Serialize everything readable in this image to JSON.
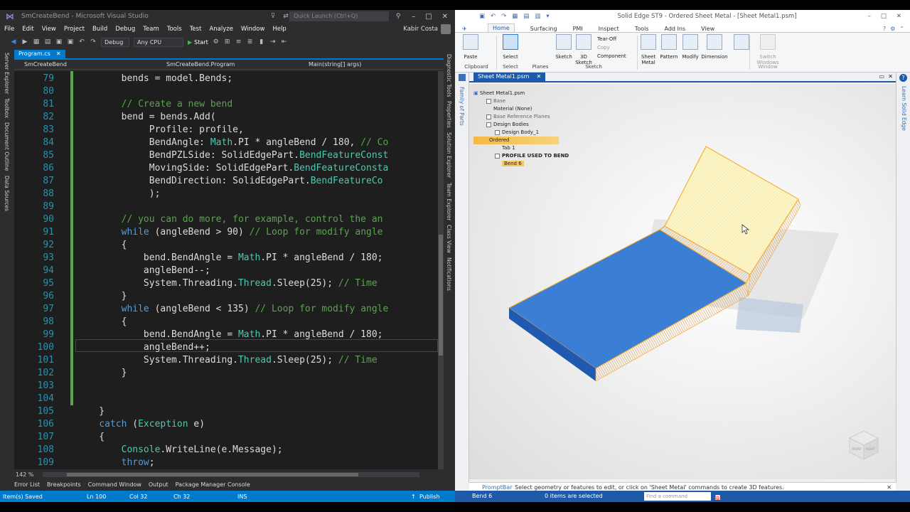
{
  "vs": {
    "window_title": "SmCreateBend - Microsoft Visual Studio",
    "quick_launch_placeholder": "Quick Launch (Ctrl+Q)",
    "menu": [
      "File",
      "Edit",
      "View",
      "Project",
      "Build",
      "Debug",
      "Team",
      "Tools",
      "Test",
      "Analyze",
      "Window",
      "Help"
    ],
    "user": "Kabir Costa",
    "toolbar": {
      "config": "Debug",
      "platform": "Any CPU",
      "start": "Start"
    },
    "left_panels": [
      "Server Explorer",
      "Toolbox",
      "Document Outline",
      "Data Sources"
    ],
    "right_panels": [
      "Diagnostic Tools",
      "Properties",
      "Solution Explorer",
      "Team Explorer",
      "Class View",
      "Notifications"
    ],
    "doc_tab": "Program.cs",
    "nav": {
      "project": "SmCreateBend",
      "class": "SmCreateBend.Program",
      "member": "Main(string[] args)"
    },
    "code_lines": [
      {
        "n": "79",
        "html": "        bends = model.Bends;"
      },
      {
        "n": "80",
        "html": ""
      },
      {
        "n": "81",
        "html": "        <span class=\"cm\">// Create a new bend</span>"
      },
      {
        "n": "82",
        "html": "        bend = bends.Add("
      },
      {
        "n": "83",
        "html": "             Profile: profile,"
      },
      {
        "n": "84",
        "html": "             BendAngle: <span class=\"ty\">Math</span>.PI * angleBend / 180, <span class=\"cm\">// Co</span>"
      },
      {
        "n": "85",
        "html": "             BendPZLSide: SolidEdgePart.<span class=\"ty\">BendFeatureConst</span>"
      },
      {
        "n": "86",
        "html": "             MovingSide: SolidEdgePart.<span class=\"ty\">BendFeatureConsta</span>"
      },
      {
        "n": "87",
        "html": "             BendDirection: SolidEdgePart.<span class=\"ty\">BendFeatureCo</span>"
      },
      {
        "n": "88",
        "html": "             );"
      },
      {
        "n": "89",
        "html": ""
      },
      {
        "n": "90",
        "html": "        <span class=\"cm\">// you can do more, for example, control the an</span>"
      },
      {
        "n": "91",
        "html": "        <span class=\"kw\">while</span> (angleBend &gt; 90) <span class=\"cm\">// Loop for modify angle</span>"
      },
      {
        "n": "92",
        "html": "        {"
      },
      {
        "n": "93",
        "html": "            bend.BendAngle = <span class=\"ty\">Math</span>.PI * angleBend / 180;"
      },
      {
        "n": "94",
        "html": "            angleBend--;"
      },
      {
        "n": "95",
        "html": "            System.Threading.<span class=\"ty\">Thread</span>.Sleep(25); <span class=\"cm\">// Time</span>"
      },
      {
        "n": "96",
        "html": "        }"
      },
      {
        "n": "97",
        "html": "        <span class=\"kw\">while</span> (angleBend &lt; 135) <span class=\"cm\">// Loop for modify angle</span>"
      },
      {
        "n": "98",
        "html": "        {"
      },
      {
        "n": "99",
        "html": "            bend.BendAngle = <span class=\"ty\">Math</span>.PI * angleBend / 180;"
      },
      {
        "n": "100",
        "html": "            angleBend++;"
      },
      {
        "n": "101",
        "html": "            System.Threading.<span class=\"ty\">Thread</span>.Sleep(25); <span class=\"cm\">// Time</span>"
      },
      {
        "n": "102",
        "html": "        }"
      },
      {
        "n": "103",
        "html": ""
      },
      {
        "n": "104",
        "html": ""
      },
      {
        "n": "105",
        "html": "    }"
      },
      {
        "n": "106",
        "html": "    <span class=\"kw\">catch</span> (<span class=\"ty\">Exception</span> e)"
      },
      {
        "n": "107",
        "html": "    {"
      },
      {
        "n": "108",
        "html": "        <span class=\"ty\">Console</span>.WriteLine(e.Message);"
      },
      {
        "n": "109",
        "html": "        <span class=\"kw\">throw</span>;"
      }
    ],
    "zoom": "142 %",
    "bottom_tabs": [
      "Error List",
      "Breakpoints",
      "Command Window",
      "Output",
      "Package Manager Console"
    ],
    "status": {
      "left": "Item(s) Saved",
      "ln": "Ln 100",
      "col": "Col 32",
      "ch": "Ch 32",
      "ins": "INS",
      "publish": "Publish"
    }
  },
  "se": {
    "window_title": "Solid Edge ST9 - Ordered Sheet Metal - [Sheet Metal1.psm]",
    "tabs": [
      "Home",
      "Surfacing",
      "PMI",
      "Inspect",
      "Tools",
      "Add Ins",
      "View"
    ],
    "ribbon": {
      "paste": "Paste",
      "clipboard": "Clipboard",
      "select": "Select",
      "select_group": "Select",
      "planes": "Planes",
      "sketch": "Sketch",
      "sketch_3d": "3D Sketch",
      "sketch_group": "Sketch",
      "tear_off": "Tear-Off",
      "copy": "Copy",
      "component": "Component",
      "sheet_metal": "Sheet Metal",
      "pattern": "Pattern",
      "modify": "Modify",
      "dimension": "Dimension",
      "switch_windows": "Switch Windows",
      "window": "Window"
    },
    "doc_tab": "Sheet Metal1.psm",
    "left_panel": "Family of Parts",
    "right_panel": "Learn Solid Edge",
    "tree": {
      "root": "Sheet Metal1.psm",
      "base": "Base",
      "material": "Material (None)",
      "base_planes": "Base Reference Planes",
      "design_bodies": "Design Bodies",
      "design_body": "Design Body_1",
      "ordered": "Ordered",
      "tab": "Tab 1",
      "profile": "PROFILE USED TO BEND",
      "bend": "Bend 6"
    },
    "prompt_label": "PromptBar",
    "prompt_text": "Select geometry or features to edit, or click on 'Sheet Metal' commands to create 3D features.",
    "view_cube": {
      "front": "FRONT",
      "right": "RIGHT"
    },
    "status": {
      "selection": "Bend 6",
      "count": "0 items are selected",
      "find_placeholder": "Find a command"
    },
    "colors": {
      "blue_face": "#3a7fd5",
      "bend_highlight": "#f5a623",
      "accent": "#1e5aa8"
    }
  }
}
